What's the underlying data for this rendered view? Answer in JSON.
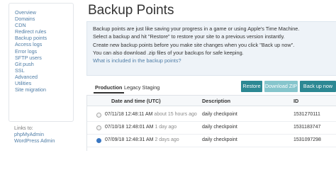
{
  "sidebar": {
    "items": [
      "Overview",
      "Domains",
      "CDN",
      "Redirect rules",
      "Backup points",
      "Access logs",
      "Error logs",
      "SFTP users",
      "Git push",
      "SSL",
      "Advanced",
      "Utilities",
      "Site migration"
    ],
    "links_title": "Links to:",
    "links": [
      "phpMyAdmin",
      "WordPress Admin"
    ]
  },
  "page": {
    "title": "Backup Points"
  },
  "info": {
    "lines": [
      "Backup points are just like saving your progress in a game or using Apple's Time Machine.",
      "Select a backup and hit \"Restore\" to restore your site to a previous version instantly.",
      "Create new backup points before you make site changes when you click \"Back up now\".",
      "You can also download .zip files of your backups for safe keeping."
    ],
    "help_link": "What is included in the backup points?"
  },
  "tabs": [
    "Production",
    "Legacy Staging"
  ],
  "buttons": {
    "restore": "Restore",
    "download": "Download ZIP",
    "backup": "Back up now"
  },
  "table": {
    "headers": [
      "Date and time (UTC)",
      "Description",
      "ID"
    ],
    "rows": [
      {
        "date": "07/11/18 12:48:11 AM",
        "ago": "about 15 hours ago",
        "desc": "daily checkpoint",
        "id": "1531270111"
      },
      {
        "date": "07/10/18 12:48:01 AM",
        "ago": "1 day ago",
        "desc": "daily checkpoint",
        "id": "1531183747"
      },
      {
        "date": "07/09/18 12:48:31 AM",
        "ago": "2 days ago",
        "desc": "daily checkpoint",
        "id": "1531097298"
      }
    ]
  },
  "colors": {
    "accent": "#2c8893",
    "accent_light": "#86c5cc",
    "link": "#4f7da6",
    "info_bg": "#eef3f8"
  }
}
